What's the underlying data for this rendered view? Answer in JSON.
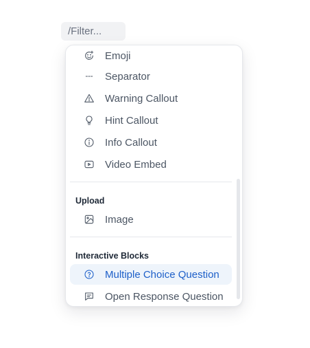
{
  "filter": {
    "placeholder": "/Filter..."
  },
  "menu": {
    "items_top": [
      {
        "label": "Emoji",
        "icon": "emoji-icon"
      },
      {
        "label": "Separator",
        "icon": "separator-icon"
      },
      {
        "label": "Warning Callout",
        "icon": "warning-icon"
      },
      {
        "label": "Hint Callout",
        "icon": "lightbulb-icon"
      },
      {
        "label": "Info Callout",
        "icon": "info-icon"
      },
      {
        "label": "Video Embed",
        "icon": "video-icon"
      }
    ],
    "upload": {
      "heading": "Upload",
      "items": [
        {
          "label": "Image",
          "icon": "image-icon"
        }
      ]
    },
    "interactive": {
      "heading": "Interactive Blocks",
      "items": [
        {
          "label": "Multiple Choice Question",
          "icon": "question-circle-icon",
          "active": true
        },
        {
          "label": "Open Response Question",
          "icon": "message-icon"
        }
      ]
    }
  },
  "colors": {
    "accent": "#1d5fc9",
    "active_bg": "#eef4fb",
    "text": "#4b5563"
  }
}
